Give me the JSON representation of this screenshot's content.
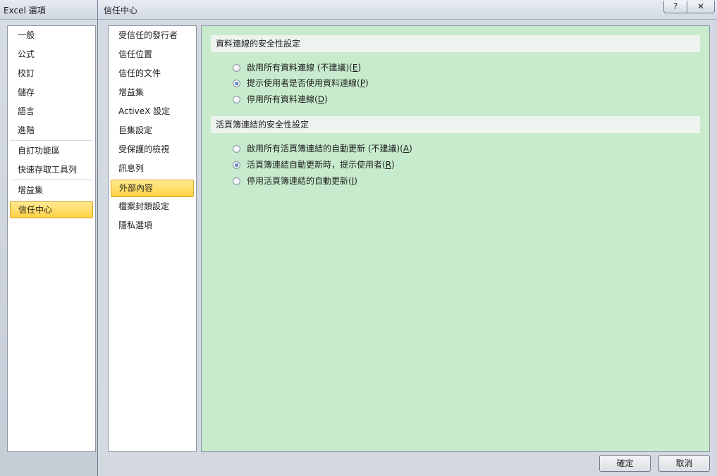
{
  "back_window": {
    "title": "Excel 選項",
    "nav_items": [
      {
        "label": "一般"
      },
      {
        "label": "公式"
      },
      {
        "label": "校訂"
      },
      {
        "label": "儲存"
      },
      {
        "label": "語言"
      },
      {
        "label": "進階"
      },
      {
        "label": "自訂功能區"
      },
      {
        "label": "快速存取工具列"
      },
      {
        "label": "增益集"
      },
      {
        "label": "信任中心",
        "selected": true
      }
    ]
  },
  "front_window": {
    "title": "信任中心",
    "help_glyph": "?",
    "close_glyph": "✕",
    "nav_items": [
      {
        "label": "受信任的發行者"
      },
      {
        "label": "信任位置"
      },
      {
        "label": "信任的文件"
      },
      {
        "label": "增益集"
      },
      {
        "label": "ActiveX 設定"
      },
      {
        "label": "巨集設定"
      },
      {
        "label": "受保護的檢視"
      },
      {
        "label": "訊息列"
      },
      {
        "label": "外部內容",
        "selected": true
      },
      {
        "label": "檔案封鎖設定"
      },
      {
        "label": "隱私選項"
      }
    ],
    "sections": [
      {
        "header": "資料連線的安全性設定",
        "options": [
          {
            "text": "啟用所有資料連線 (不建議)(",
            "key": "E",
            "close": ")",
            "checked": false
          },
          {
            "text": "提示使用者是否使用資料連線(",
            "key": "P",
            "close": ")",
            "checked": true
          },
          {
            "text": "停用所有資料連線(",
            "key": "D",
            "close": ")",
            "checked": false
          }
        ]
      },
      {
        "header": "活頁簿連結的安全性設定",
        "options": [
          {
            "text": "啟用所有活頁簿連結的自動更新 (不建議)(",
            "key": "A",
            "close": ")",
            "checked": false
          },
          {
            "text": "活頁簿連結自動更新時，提示使用者(",
            "key": "R",
            "close": ")",
            "checked": true
          },
          {
            "text": "停用活頁簿連結的自動更新(",
            "key": "I",
            "close": ")",
            "checked": false
          }
        ]
      }
    ],
    "buttons": {
      "ok": "確定",
      "cancel": "取消"
    }
  }
}
